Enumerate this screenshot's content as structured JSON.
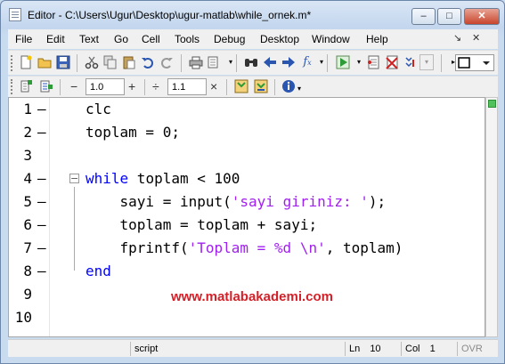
{
  "window": {
    "title": "Editor - C:\\Users\\Ugur\\Desktop\\ugur-matlab\\while_ornek.m*",
    "minimize": "–",
    "maximize": "□",
    "close": "✕"
  },
  "menu": {
    "items": [
      "File",
      "Edit",
      "Text",
      "Go",
      "Cell",
      "Tools",
      "Debug",
      "Desktop",
      "Window",
      "Help"
    ],
    "dock_controls": [
      "↘",
      "✕"
    ]
  },
  "toolbar": {
    "icons": [
      "new-file-icon",
      "open-folder-icon",
      "save-icon",
      "cut-icon",
      "copy-icon",
      "paste-icon",
      "undo-icon",
      "redo-icon",
      "print-icon",
      "compare-icon",
      "find-icon",
      "back-icon",
      "forward-icon",
      "function-icon",
      "run-icon",
      "set-breakpoint-icon",
      "clear-breakpoints-icon",
      "stack-icon",
      "layout-icon"
    ]
  },
  "cell_toolbar": {
    "minus": "−",
    "value_1": "1.0",
    "plus": "+",
    "divide": "÷",
    "value_2": "1.1",
    "times": "×"
  },
  "code_lines": [
    {
      "n": "1",
      "dash": true,
      "tokens": [
        {
          "t": "clc",
          "c": "plain"
        }
      ]
    },
    {
      "n": "2",
      "dash": true,
      "tokens": [
        {
          "t": "toplam = 0;",
          "c": "plain"
        }
      ]
    },
    {
      "n": "3",
      "dash": false,
      "tokens": []
    },
    {
      "n": "4",
      "dash": true,
      "tokens": [
        {
          "t": "while",
          "c": "kw"
        },
        {
          "t": " toplam < 100",
          "c": "plain"
        }
      ]
    },
    {
      "n": "5",
      "dash": true,
      "tokens": [
        {
          "t": "    sayi = input(",
          "c": "plain"
        },
        {
          "t": "'sayi giriniz: '",
          "c": "str"
        },
        {
          "t": ");",
          "c": "plain"
        }
      ]
    },
    {
      "n": "6",
      "dash": true,
      "tokens": [
        {
          "t": "    toplam = toplam + sayi;",
          "c": "plain"
        }
      ]
    },
    {
      "n": "7",
      "dash": true,
      "tokens": [
        {
          "t": "    fprintf(",
          "c": "plain"
        },
        {
          "t": "'Toplam = %d \\n'",
          "c": "str"
        },
        {
          "t": ", toplam)",
          "c": "plain"
        }
      ]
    },
    {
      "n": "8",
      "dash": true,
      "tokens": [
        {
          "t": "end",
          "c": "kw"
        }
      ]
    },
    {
      "n": "9",
      "dash": false,
      "tokens": []
    },
    {
      "n": "10",
      "dash": false,
      "tokens": []
    }
  ],
  "watermark": "www.matlabakademi.com",
  "status": {
    "mode": "script",
    "ln_label": "Ln",
    "ln_value": "10",
    "col_label": "Col",
    "col_value": "1",
    "ovr": "OVR"
  },
  "colors": {
    "keyword": "#0000ff",
    "string": "#a020f0",
    "watermark": "#d42028"
  }
}
